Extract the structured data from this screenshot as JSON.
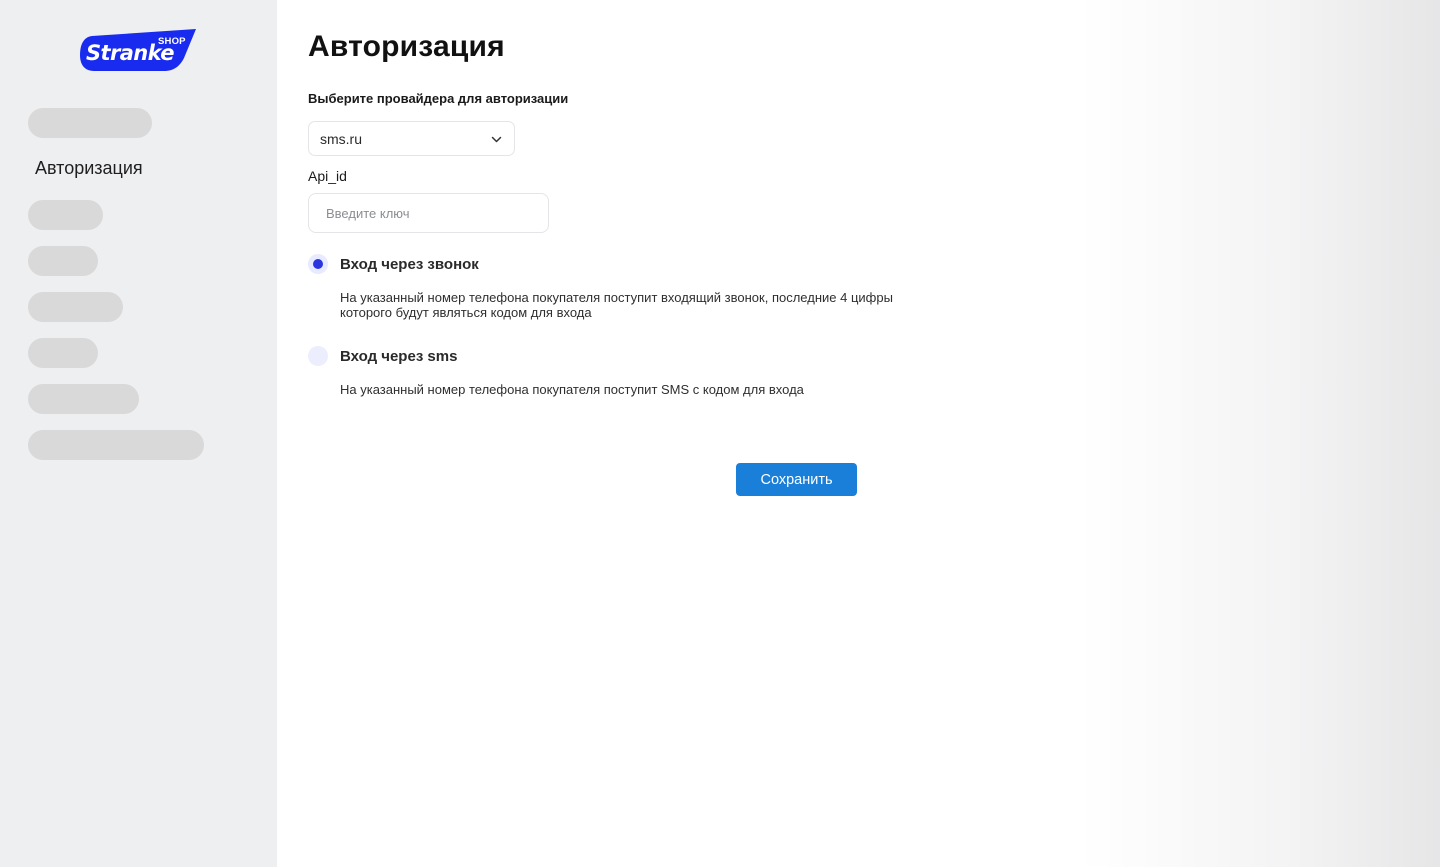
{
  "brand": {
    "name": "Stranke",
    "tag": "SHOP",
    "accent": "#1a2bf0"
  },
  "sidebar": {
    "active_item": "Авторизация"
  },
  "main": {
    "title": "Авторизация",
    "provider_label": "Выберите провайдера для авторизации",
    "provider_value": "sms.ru",
    "api_label": "Api_id",
    "api_placeholder": "Введите ключ",
    "api_value": "",
    "options": [
      {
        "title": "Вход через звонок",
        "description": "На указанный номер телефона покупателя поступит входящий звонок, последние 4 цифры которого будут являться кодом для входа",
        "selected": true
      },
      {
        "title": "Вход через sms",
        "description": "На указанный номер телефона покупателя поступит SMS с кодом для входа",
        "selected": false
      }
    ],
    "save_label": "Сохранить"
  },
  "colors": {
    "primary_button": "#1a7fd9",
    "radio_selected": "#2a35e0",
    "sidebar_bg": "#eeeff1"
  }
}
